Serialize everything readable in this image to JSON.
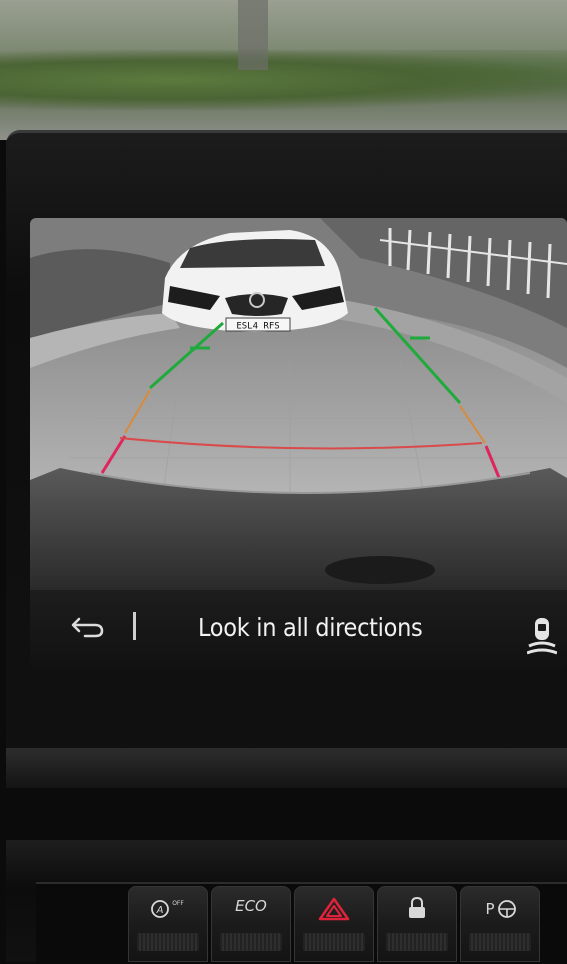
{
  "status_bar": {
    "message": "Look in all directions",
    "back_icon": "back-arrow-icon",
    "sensor_icon": "parking-sensor-icon"
  },
  "camera": {
    "license_plate": "ESL4 RFS",
    "guide_colors": {
      "near": "#e0245e",
      "far": "#1faa3c"
    }
  },
  "console_buttons": [
    {
      "id": "auto-start-stop",
      "icon": "auto-start-stop-off-icon",
      "label": "A OFF"
    },
    {
      "id": "eco",
      "icon": "eco-icon",
      "label": "ECO"
    },
    {
      "id": "hazard",
      "icon": "hazard-triangle-icon",
      "label": ""
    },
    {
      "id": "lock",
      "icon": "lock-icon",
      "label": ""
    },
    {
      "id": "park-assist",
      "icon": "park-assist-icon",
      "label": "P"
    }
  ]
}
